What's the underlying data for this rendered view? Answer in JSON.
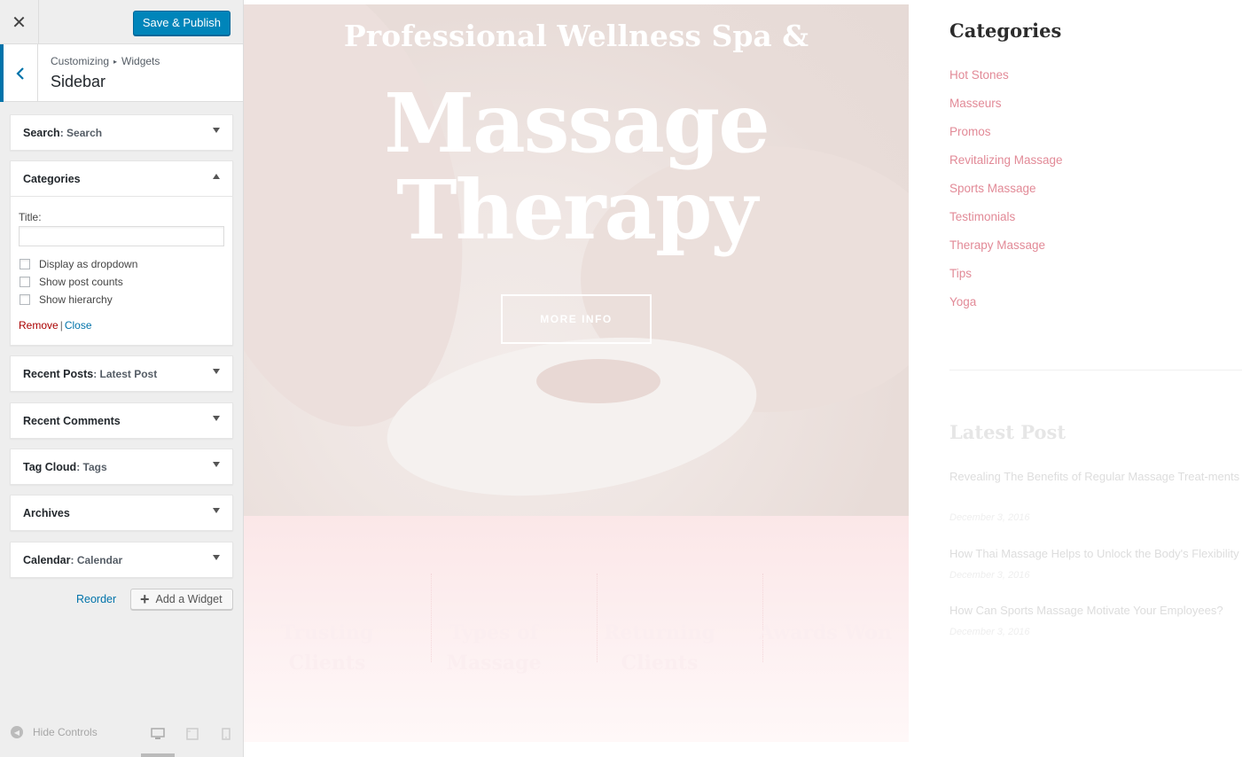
{
  "customizer": {
    "close_icon": "close-icon",
    "save_label": "Save & Publish",
    "breadcrumb": {
      "parent": "Customizing",
      "separator": "▸",
      "current": "Widgets"
    },
    "section_title": "Sidebar",
    "widgets": [
      {
        "name": "Search",
        "title": "Search",
        "state": "collapsed"
      },
      {
        "name": "Categories",
        "title": "",
        "state": "expanded"
      },
      {
        "name": "Recent Posts",
        "title": "Latest Post",
        "state": "collapsed"
      },
      {
        "name": "Recent Comments",
        "title": "",
        "state": "collapsed"
      },
      {
        "name": "Tag Cloud",
        "title": "Tags",
        "state": "collapsed"
      },
      {
        "name": "Archives",
        "title": "",
        "state": "collapsed"
      },
      {
        "name": "Calendar",
        "title": "Calendar",
        "state": "collapsed"
      }
    ],
    "categories_form": {
      "title_label": "Title:",
      "title_value": "",
      "checkboxes": [
        {
          "label": "Display as dropdown",
          "checked": false
        },
        {
          "label": "Show post counts",
          "checked": false
        },
        {
          "label": "Show hierarchy",
          "checked": false
        }
      ],
      "remove_label": "Remove",
      "close_label": "Close",
      "separator": "|"
    },
    "reorder_label": "Reorder",
    "add_widget_label": "Add a Widget",
    "hide_controls_label": "Hide Controls",
    "accent_color": "#0073aa",
    "save_color": "#0085ba"
  },
  "preview": {
    "hero": {
      "subtitle": "Professional Wellness Spa &",
      "title_line1": "Massage",
      "title_line2": "Therapy",
      "button_label": "MORE INFO"
    },
    "stats": [
      "Trusting Clients",
      "Types of Massage",
      "Returning Clients",
      "Awards Won"
    ],
    "sidebar": {
      "categories_title": "Categories",
      "categories": [
        "Hot Stones",
        "Masseurs",
        "Promos",
        "Revitalizing Massage",
        "Sports Massage",
        "Testimonials",
        "Therapy Massage",
        "Tips",
        "Yoga"
      ],
      "latest_title": "Latest Post",
      "posts": [
        {
          "title": "Revealing The Benefits of Regular Massage Treat-ments",
          "date": "December 3, 2016"
        },
        {
          "title": "How Thai Massage Helps to Unlock the Body's Flexibility",
          "date": "December 3, 2016"
        },
        {
          "title": "How Can Sports Massage Motivate Your Employees?",
          "date": "December 3, 2016"
        }
      ],
      "link_color": "#e28a97"
    }
  }
}
